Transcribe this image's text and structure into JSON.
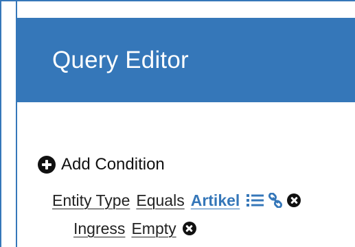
{
  "header": {
    "title": "Query Editor"
  },
  "actions": {
    "add_condition_label": "Add Condition",
    "add_icon": "plus-circle-icon"
  },
  "conditions": [
    {
      "field": "Entity Type",
      "operator": "Equals",
      "value": "Artikel",
      "icons": [
        "list-icon",
        "link-icon",
        "remove-circle-icon"
      ]
    },
    {
      "field": "Ingress",
      "operator": "Empty",
      "icons": [
        "remove-circle-icon"
      ]
    }
  ],
  "colors": {
    "accent": "#3577b9",
    "header_text": "#ffffff",
    "text": "#222222",
    "icon": "#111111"
  }
}
